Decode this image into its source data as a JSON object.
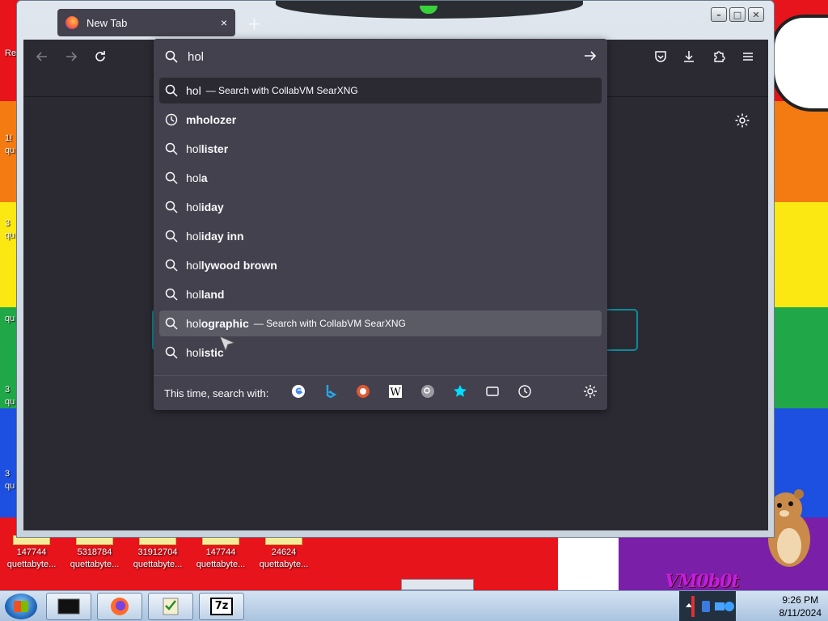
{
  "browser": {
    "tab_title": "New Tab",
    "tab_close": "×",
    "new_tab": "+"
  },
  "window_controls": {
    "minimize": "–",
    "maximize": "□",
    "close": "✕"
  },
  "urlbar": {
    "value": "hol",
    "suggestions": [
      {
        "typed": "hol",
        "rest": "",
        "suffix": "— Search with CollabVM SearXNG",
        "icon": "search-icon",
        "state": "selected"
      },
      {
        "typed": "",
        "rest": "mholozer",
        "suffix": "",
        "icon": "history-icon",
        "state": ""
      },
      {
        "typed": "hol",
        "rest": "lister",
        "suffix": "",
        "icon": "search-icon",
        "state": ""
      },
      {
        "typed": "hol",
        "rest": "a",
        "suffix": "",
        "icon": "search-icon",
        "state": ""
      },
      {
        "typed": "hol",
        "rest": "iday",
        "suffix": "",
        "icon": "search-icon",
        "state": ""
      },
      {
        "typed": "hol",
        "rest": "iday inn",
        "suffix": "",
        "icon": "search-icon",
        "state": ""
      },
      {
        "typed": "hol",
        "rest": "lywood brown",
        "suffix": "",
        "icon": "search-icon",
        "state": ""
      },
      {
        "typed": "hol",
        "rest": "land",
        "suffix": "",
        "icon": "search-icon",
        "state": ""
      },
      {
        "typed": "hol",
        "rest": "ographic",
        "suffix": "— Search with CollabVM SearXNG",
        "icon": "search-icon",
        "state": "hover"
      },
      {
        "typed": "hol",
        "rest": "istic",
        "suffix": "",
        "icon": "search-icon",
        "state": ""
      }
    ],
    "one_off_label": "This time, search with:",
    "engines": [
      "google-icon",
      "bing-icon",
      "duckduckgo-icon",
      "wikipedia-icon",
      "searxng-icon",
      "bookmarks-icon",
      "tabs-icon",
      "history-icon"
    ]
  },
  "desktop": {
    "left_edge_texts": [
      "Re",
      "1!",
      "qu",
      "3",
      "qu",
      "qu",
      "3",
      "qu",
      "3",
      "qu"
    ],
    "icons": [
      {
        "size": "147744",
        "name": "quettabyte..."
      },
      {
        "size": "5318784",
        "name": "quettabyte..."
      },
      {
        "size": "31912704",
        "name": "quettabyte..."
      },
      {
        "size": "147744",
        "name": "quettabyte..."
      },
      {
        "size": "24624",
        "name": "quettabyte..."
      }
    ],
    "wallpaper_text": "VM0b0t"
  },
  "taskbar": {
    "apps": [
      "terminal-icon",
      "firefox-icon",
      "checklist-icon",
      "7zip-icon"
    ],
    "app_7z_label": "7z",
    "clock_time": "9:26 PM",
    "clock_date": "8/11/2024"
  },
  "colors": {
    "firefox_panel": "#42414d",
    "firefox_chrome": "#2b2a33",
    "focus_ring": "#0e8a9a"
  }
}
